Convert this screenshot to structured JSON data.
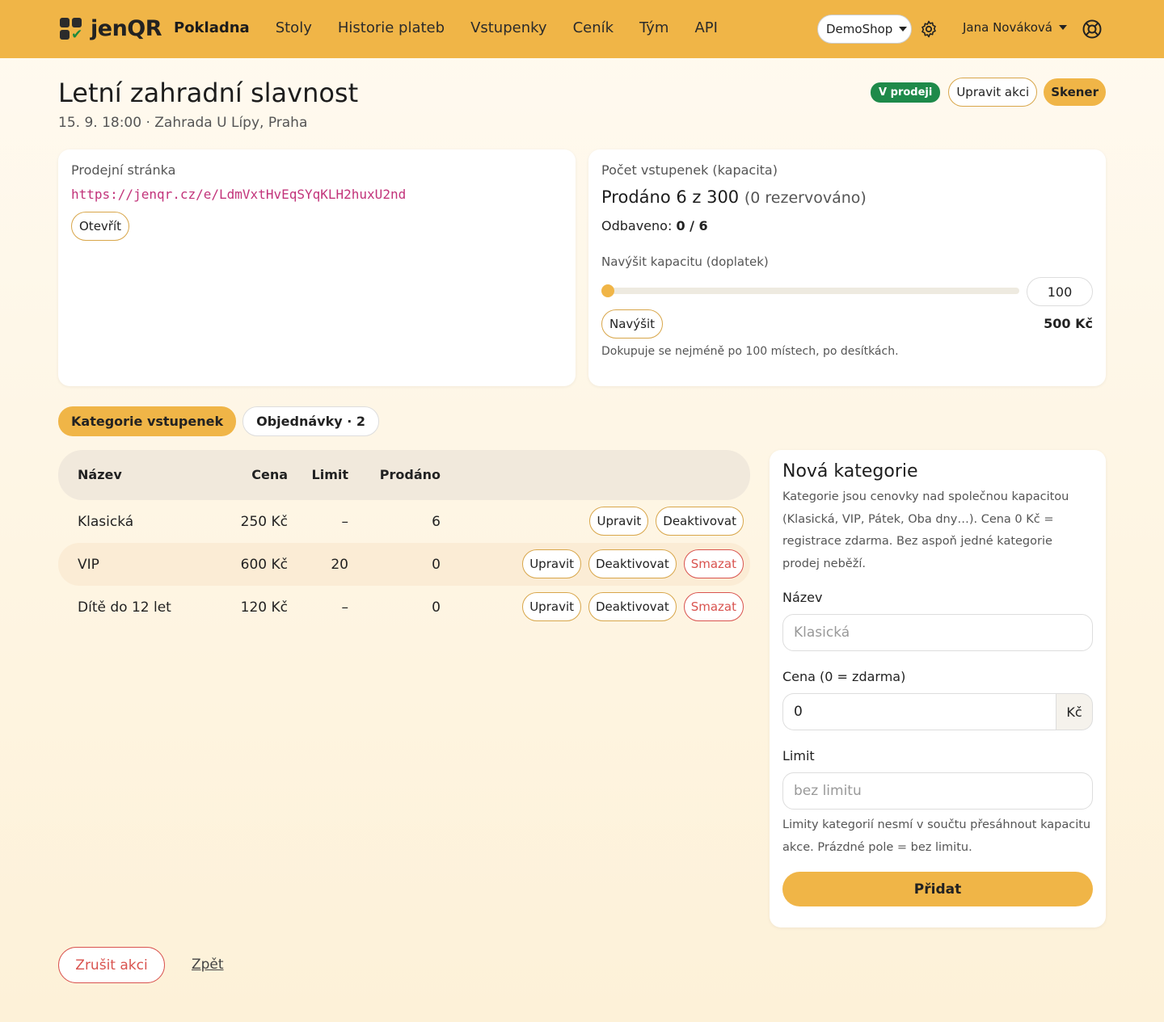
{
  "navbar": {
    "brand": "jenQR",
    "links": [
      "Pokladna",
      "Stoly",
      "Historie plateb",
      "Vstupenky",
      "Ceník",
      "Tým",
      "API"
    ],
    "shop": "DemoShop",
    "user": "Jana Nováková"
  },
  "event": {
    "title": "Letní zahradní slavnost",
    "subtitle": "15. 9. 18:00 · Zahrada U Lípy, Praha",
    "status_badge": "V prodeji",
    "edit_label": "Upravit akci",
    "scanner_label": "Skener"
  },
  "sales": {
    "label": "Prodejní stránka",
    "url": "https://jenqr.cz/e/LdmVxtHvEqSYqKLH2huxU2nd",
    "open_label": "Otevřít"
  },
  "capacity": {
    "label": "Počet vstupenek (kapacita)",
    "sold_text": "Prodáno 6 z 300",
    "reserved_text": "(0 rezervováno)",
    "scanned_label": "Odbaveno:",
    "scanned_value": "0 / 6",
    "raise_label": "Navýšit kapacitu (doplatek)",
    "raise_value": "100",
    "slider_fraction": 0,
    "raise_button": "Navýšit",
    "raise_price": "500 Kč",
    "note": "Dokupuje se nejméně po 100 místech, po desítkách."
  },
  "tabs": [
    {
      "label": "Kategorie vstupenek",
      "active": true
    },
    {
      "label": "Objednávky · 2",
      "active": false
    }
  ],
  "table": {
    "headers": {
      "name": "Název",
      "price": "Cena",
      "limit": "Limit",
      "sold": "Prodáno"
    },
    "rows": [
      {
        "name": "Klasická",
        "price": "250 Kč",
        "limit": "–",
        "sold": "6"
      },
      {
        "name": "VIP",
        "price": "600 Kč",
        "limit": "20",
        "sold": "0"
      },
      {
        "name": "Dítě do 12 let",
        "price": "120 Kč",
        "limit": "–",
        "sold": "0"
      }
    ],
    "actions": {
      "edit": "Upravit",
      "deactivate": "Deaktivovat",
      "delete": "Smazat"
    }
  },
  "new_category": {
    "title": "Nová kategorie",
    "description": "Kategorie jsou cenovky nad společnou kapacitou (Klasická, VIP, Pátek, Oba dny…). Cena 0 Kč = registrace zdarma. Bez aspoň jedné kategorie prodej neběží.",
    "name_label": "Název",
    "name_placeholder": "Klasická",
    "price_label": "Cena (0 = zdarma)",
    "price_value": "0",
    "currency": "Kč",
    "limit_label": "Limit",
    "limit_placeholder": "bez limitu",
    "limit_note": "Limity kategorií nesmí v součtu přesáhnout kapacitu akce. Prázdné pole = bez limitu.",
    "add_button": "Přidat"
  },
  "footer": {
    "cancel_label": "Zrušit akci",
    "back_label": "Zpět"
  },
  "colors": {
    "brand": "#f0b547",
    "success": "#1e8a4a",
    "danger": "#d9534f",
    "url": "#c2337a"
  }
}
